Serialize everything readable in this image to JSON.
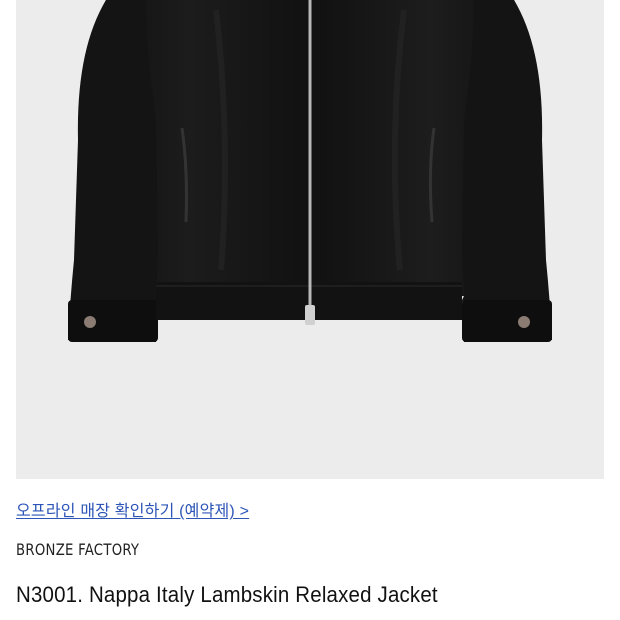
{
  "product": {
    "image_alt": "black leather jacket",
    "store_link": "오프라인 매장 확인하기 (예약제) >",
    "brand": "BRONZE FACTORY",
    "name": "N3001. Nappa Italy Lambskin Relaxed Jacket"
  },
  "colors": {
    "image_background": "#ececec",
    "jacket": "#151515",
    "link": "#2d55b8",
    "text": "#111111"
  },
  "icons": {
    "zipper": "zipper-icon",
    "snap_button": "snap-button-icon"
  }
}
